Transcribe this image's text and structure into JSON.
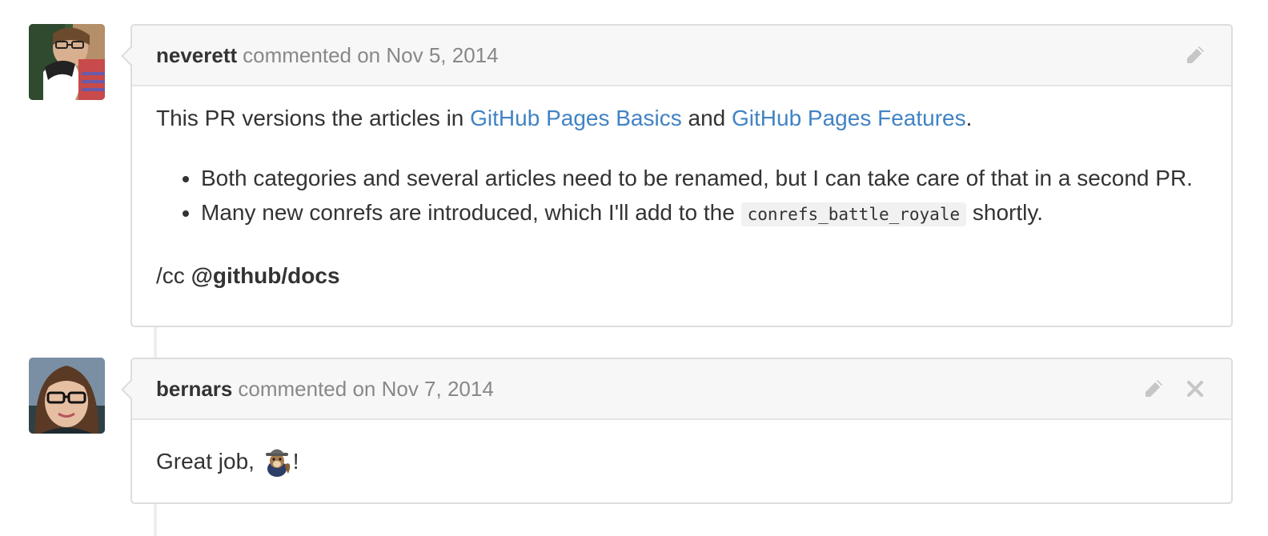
{
  "comments": [
    {
      "author": "neverett",
      "timestamp": "commented on Nov 5, 2014",
      "intro_text": "This PR versions the articles in ",
      "link1": "GitHub Pages Basics",
      "and_text": " and ",
      "link2": "GitHub Pages Features",
      "period": ".",
      "bullets": [
        {
          "text": "Both categories and several articles need to be renamed, but I can take care of that in a second PR."
        },
        {
          "before": "Many new conrefs are introduced, which I'll add to the ",
          "code": "conrefs_battle_royale",
          "after": " shortly."
        }
      ],
      "cc_prefix": "/cc ",
      "cc_mention": "@github/docs",
      "actions": [
        "pencil-icon"
      ]
    },
    {
      "author": "bernars",
      "timestamp": "commented on Nov 7, 2014",
      "body_before": "Great job, ",
      "body_emoji": "squirrel-spy-emoji",
      "body_after": "!",
      "actions": [
        "pencil-icon",
        "close-icon"
      ]
    }
  ],
  "colors": {
    "link": "#4183c4",
    "text": "#333333",
    "muted": "#888888",
    "header_bg": "#f7f7f7",
    "border": "#dddddd",
    "icon": "#c6c6c6"
  }
}
